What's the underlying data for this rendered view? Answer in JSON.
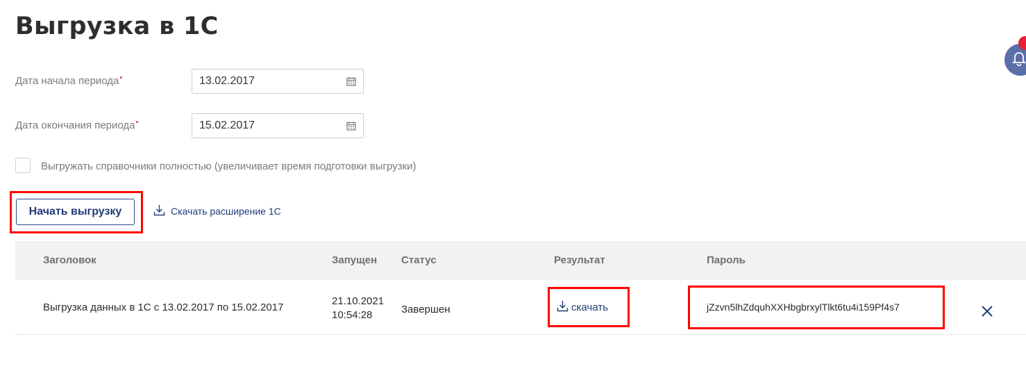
{
  "page": {
    "title": "Выгрузка в 1С"
  },
  "form": {
    "start_date": {
      "label": "Дата начала периода",
      "value": "13.02.2017"
    },
    "end_date": {
      "label": "Дата окончания периода",
      "value": "15.02.2017"
    },
    "required_mark": "•",
    "full_refs": {
      "label": "Выгружать справочники полностью (увеличивает время подготовки выгрузки)",
      "checked": false
    }
  },
  "actions": {
    "start_label": "Начать выгрузку",
    "extension_label": "Скачать расширение 1С"
  },
  "table": {
    "columns": [
      "Заголовок",
      "Запущен",
      "Статус",
      "Результат",
      "Пароль"
    ],
    "rows": [
      {
        "title": "Выгрузка данных в 1С с 13.02.2017 по 15.02.2017",
        "started_date": "21.10.2021",
        "started_time": "10:54:28",
        "status": "Завершен",
        "result_label": "скачать",
        "password": "jZzvn5lhZdquhXXHbgbrxylTlkt6tu4i159Pf4s7"
      }
    ]
  },
  "colors": {
    "accent": "#1f3a78",
    "highlight": "#ff0000",
    "badge": "#e8203a",
    "bell": "#5b6fa8"
  },
  "icons": [
    "calendar-icon",
    "download-icon",
    "close-icon",
    "bell-icon"
  ]
}
